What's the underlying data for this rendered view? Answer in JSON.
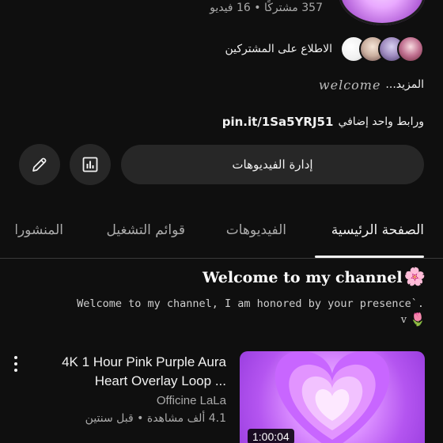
{
  "channel": {
    "stats": "357 مشتركًا • 16 فيديو"
  },
  "subscribers": {
    "label": "الاطلاع على المشتركين"
  },
  "description": {
    "more_label": "المزيد...",
    "welcome_script": "welcome"
  },
  "links": {
    "url": "pin.it/1Sa5YRJ51",
    "extra": "ورابط واحد إضافي"
  },
  "actions": {
    "manage_videos": "إدارة الفيديوهات",
    "stats_icon": "bar-chart-icon",
    "edit_icon": "pencil-icon"
  },
  "tabs": [
    {
      "label": "الصفحة الرئيسية",
      "active": true
    },
    {
      "label": "الفيديوهات",
      "active": false
    },
    {
      "label": "قوائم التشغيل",
      "active": false
    },
    {
      "label": "المنشورات",
      "active": false
    }
  ],
  "welcome": {
    "title": "Welcome to my channel",
    "title_emoji": "🌸",
    "subtitle": "Welcome to my channel, I am honored by your presence`.",
    "v_mark": "v",
    "tulip_emoji": "🌷"
  },
  "video": {
    "title": "4K 1 Hour Pink Purple Aura Heart Overlay Loop ...",
    "channel": "Officine LaLa",
    "meta": "4.1 ألف مشاهدة • قبل سنتين",
    "duration": "1:00:04",
    "menu_icon": "more-vertical-icon"
  },
  "colors": {
    "background": "#0f0f0f",
    "button": "#272727",
    "text_primary": "#f1f1f1",
    "text_secondary": "#aaaaaa"
  }
}
